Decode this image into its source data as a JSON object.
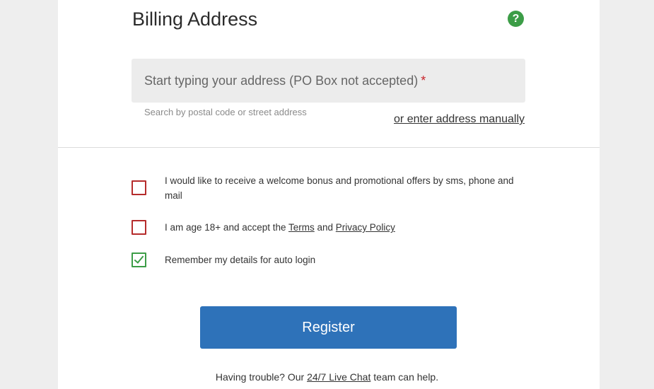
{
  "billing": {
    "title": "Billing Address",
    "help_icon": "question-mark-icon",
    "address_placeholder": "Start typing your address (PO Box not accepted)",
    "required_mark": "*",
    "hint": "Search by postal code or street address",
    "manual_link": "or enter address manually"
  },
  "consents": {
    "promo": {
      "label": "I would like to receive a welcome bonus and promotional offers by sms, phone and mail",
      "checked": false
    },
    "age": {
      "prefix": "I am age 18+ and accept the ",
      "terms_link": "Terms",
      "and": " and ",
      "privacy_link": "Privacy Policy",
      "checked": false
    },
    "remember": {
      "label": "Remember my details for auto login",
      "checked": true
    }
  },
  "register_label": "Register",
  "footer": {
    "prefix": "Having trouble? Our ",
    "live_chat_link": "24/7 Live Chat",
    "suffix": " team can help."
  },
  "colors": {
    "primary_button": "#2e72b9",
    "help_icon": "#3c9d47",
    "unchecked_border": "#b52b2b",
    "checked_border": "#3c9d47",
    "required": "#c8242b"
  }
}
